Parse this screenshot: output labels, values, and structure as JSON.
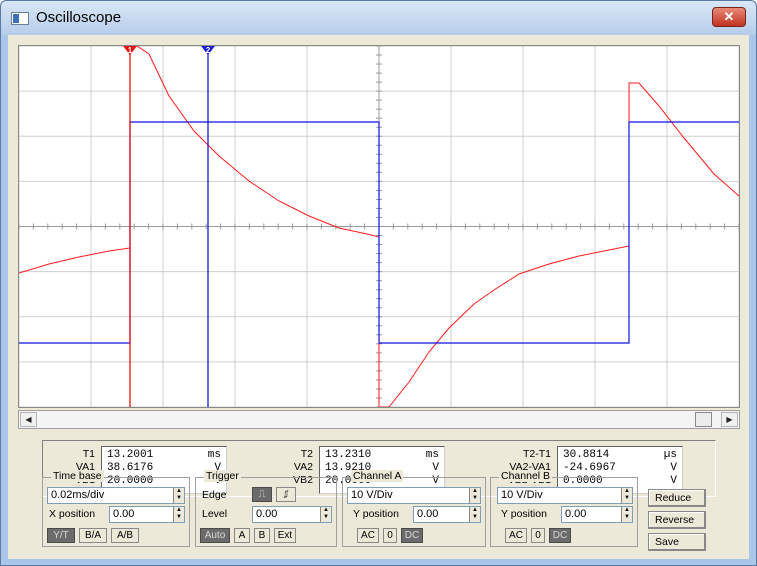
{
  "window": {
    "title": "Oscilloscope",
    "close_glyph": "✕"
  },
  "scrollbar": {
    "left_glyph": "◀",
    "right_glyph": "▶"
  },
  "cursors": {
    "c1_label": "1",
    "c2_label": "2",
    "c1_color": "#e81010",
    "c2_color": "#1a1ad8"
  },
  "traces": {
    "channel_a_color": "#ff1a1a",
    "channel_b_color": "#1010e0"
  },
  "readout": {
    "g1": {
      "labels": [
        "T1",
        "VA1",
        "VB1"
      ],
      "values": [
        [
          "13.2001",
          "ms"
        ],
        [
          "38.6176",
          "V"
        ],
        [
          "20.0000",
          "V"
        ]
      ]
    },
    "g2": {
      "labels": [
        "T2",
        "VA2",
        "VB2"
      ],
      "values": [
        [
          "13.2310",
          "ms"
        ],
        [
          "13.9210",
          "V"
        ],
        [
          "20.0000",
          "V"
        ]
      ]
    },
    "g3": {
      "labels": [
        "T2-T1",
        "VA2-VA1",
        "VB2-VB1"
      ],
      "values": [
        [
          "30.8814",
          "µs"
        ],
        [
          "-24.6967",
          "V"
        ],
        [
          "0.0000",
          "V"
        ]
      ]
    }
  },
  "timebase": {
    "legend": "Time base",
    "value": "0.02ms/div",
    "xpos_label": "X position",
    "xpos_value": "0.00",
    "buttons": [
      "Y/T",
      "B/A",
      "A/B"
    ]
  },
  "trigger": {
    "legend": "Trigger",
    "edge_label": "Edge",
    "edge_rise": "⎍",
    "edge_fall": "⎎",
    "level_label": "Level",
    "level_value": "0.00",
    "buttons": [
      "Auto",
      "A",
      "B",
      "Ext"
    ]
  },
  "channel_a": {
    "legend": "Channel A",
    "value": "10 V/Div",
    "ypos_label": "Y position",
    "ypos_value": "0.00",
    "buttons": [
      "AC",
      "0",
      "DC"
    ]
  },
  "channel_b": {
    "legend": "Channel B",
    "value": "10 V/Div",
    "ypos_label": "Y position",
    "ypos_value": "0.00",
    "buttons": [
      "AC",
      "0",
      "DC"
    ]
  },
  "actions": {
    "reduce": "Reduce",
    "reverse": "Reverse",
    "save": "Save"
  },
  "spin": {
    "up": "▲",
    "down": "▼"
  }
}
